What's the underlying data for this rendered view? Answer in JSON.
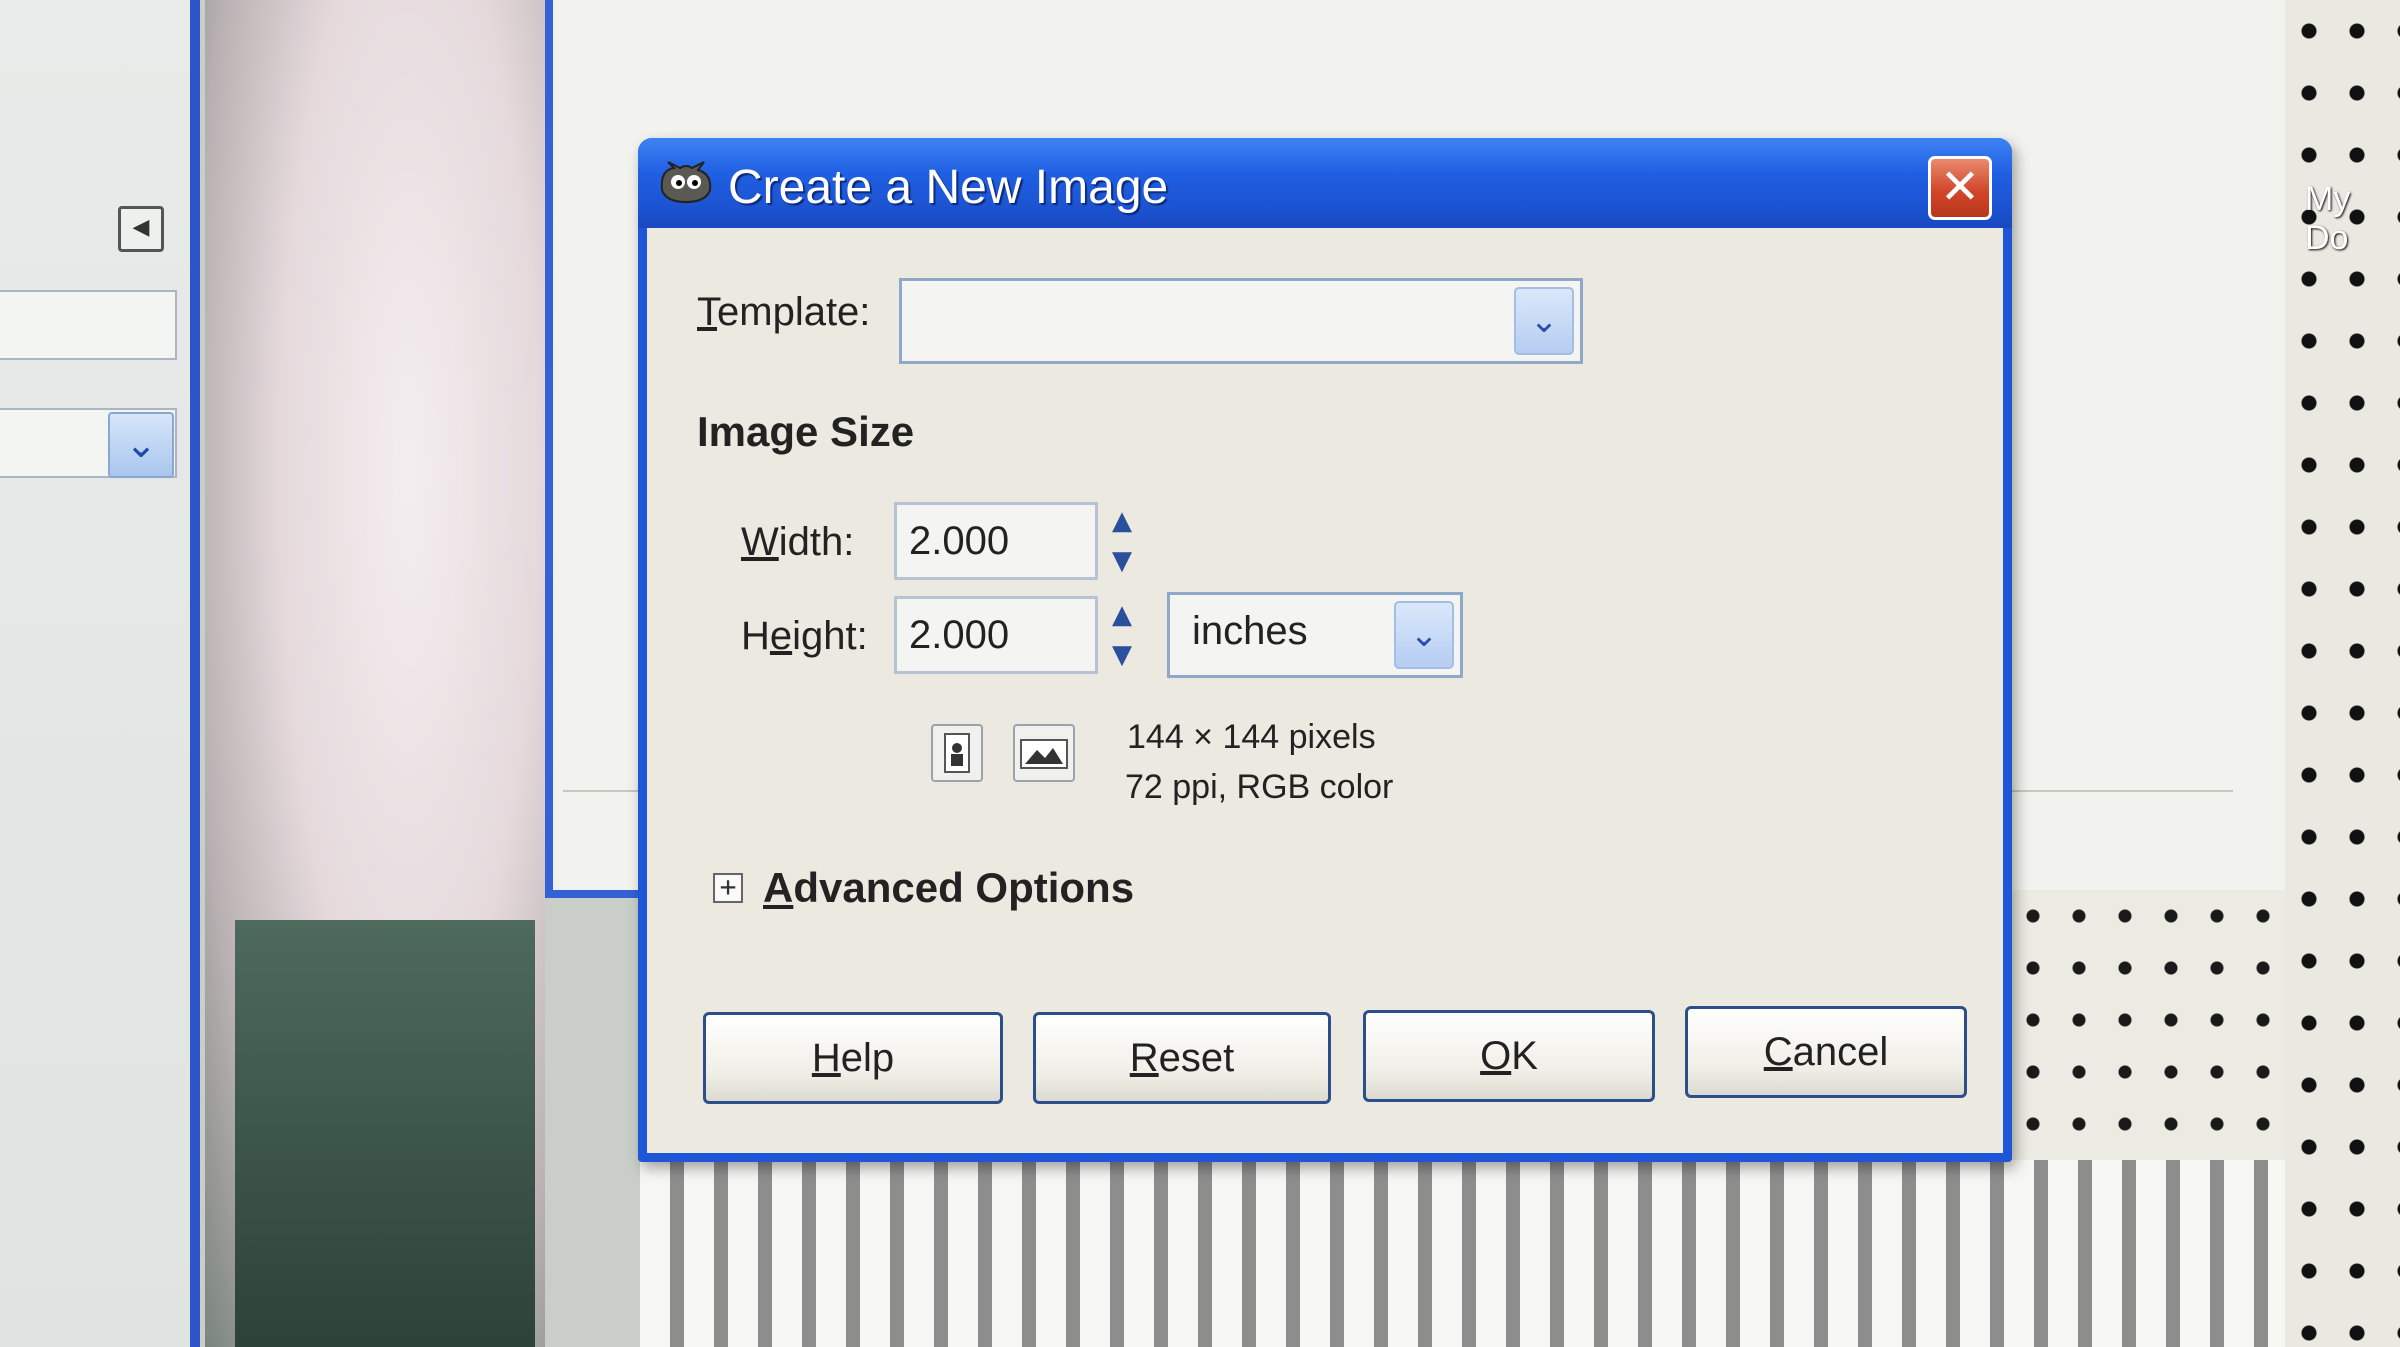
{
  "background": {
    "desktop_label": "My Do"
  },
  "dialog": {
    "title": "Create a New Image",
    "close_glyph": "✕",
    "template": {
      "label_accel": "T",
      "label_rest": "emplate:",
      "value": ""
    },
    "image_size": {
      "heading": "Image Size",
      "width": {
        "label_pre": "",
        "label_accel": "W",
        "label_rest": "idth:",
        "value": "2.000"
      },
      "height": {
        "label_pre": "H",
        "label_accel": "e",
        "label_rest": "ight:",
        "value": "2.000"
      },
      "unit": "inches",
      "pixels_info": "144 × 144 pixels",
      "resolution_info": "72 ppi, RGB color"
    },
    "advanced": {
      "expander_glyph": "+",
      "label_accel": "A",
      "label_rest": "dvanced Options"
    },
    "buttons": {
      "help": {
        "accel": "H",
        "rest": "elp"
      },
      "reset": {
        "accel": "R",
        "rest": "eset"
      },
      "ok": {
        "accel": "O",
        "rest": "K"
      },
      "cancel": {
        "accel": "C",
        "rest": "ancel"
      }
    }
  },
  "colors": {
    "titlebar": "#1f5fe2",
    "close": "#d2472b",
    "dialog_bg": "#eceae0",
    "accent_border": "#1f56d8"
  }
}
